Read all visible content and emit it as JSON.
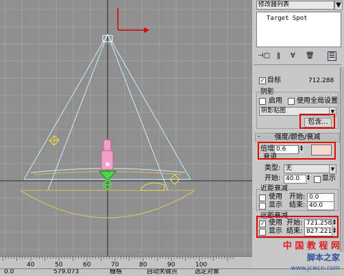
{
  "panel": {
    "header": "修改器列表",
    "stack_item": "Target Spot",
    "toolbar_icons": [
      "pin-icon",
      "show-end-result-icon",
      "make-unique-icon",
      "remove-modifier-icon",
      "configure-sets-icon"
    ],
    "target_label": "目标",
    "target_value": "712.288",
    "shadow": {
      "group": "阴影",
      "enabled_label": "启用",
      "global_label": "使用全局设置",
      "type_value": "阴影贴图",
      "exclude_button": "包含..."
    },
    "intensity": {
      "rollout_title": "强度/颜色/衰减",
      "multiplier_label": "倍增:",
      "multiplier_value": "0.6",
      "color_hex": "#f7d8cf",
      "decay_label": "衰退",
      "type_label": "类型:",
      "type_value": "无",
      "start_label": "开始:",
      "start_value": "40.0",
      "show_label": "显示"
    },
    "near_atten": {
      "group": "近距衰减",
      "use_label": "使用",
      "show_label": "显示",
      "start_label": "开始:",
      "end_label": "结束:",
      "start_value": "0.0",
      "end_value": "40.0"
    },
    "far_atten": {
      "group": "远距衰减",
      "use_label": "使用",
      "show_label": "显示",
      "start_label": "开始:",
      "end_label": "结束:",
      "start_value": "721.258",
      "end_value": "827.221"
    }
  },
  "timeline": {
    "ticks": [
      "40",
      "50",
      "60",
      "70",
      "80",
      "90",
      "100"
    ]
  },
  "statusbar": {
    "left_value": "0.0",
    "coord_value": "579.073",
    "grid_label": "栅格",
    "autokey_label": "自动关键点",
    "selected_label": "选定对象"
  },
  "watermark": {
    "line1": "中 国 教 程 网",
    "line2": "www.jcwcn.com",
    "sub": "脚本之家"
  },
  "colors": {
    "viewport_bg": "#8f8f8f",
    "grid": "#a2a2a2",
    "cone": "#c8f0ff",
    "highlight": "#e00000",
    "light_body": "#f0a0c8",
    "light_green": "#48d848"
  }
}
